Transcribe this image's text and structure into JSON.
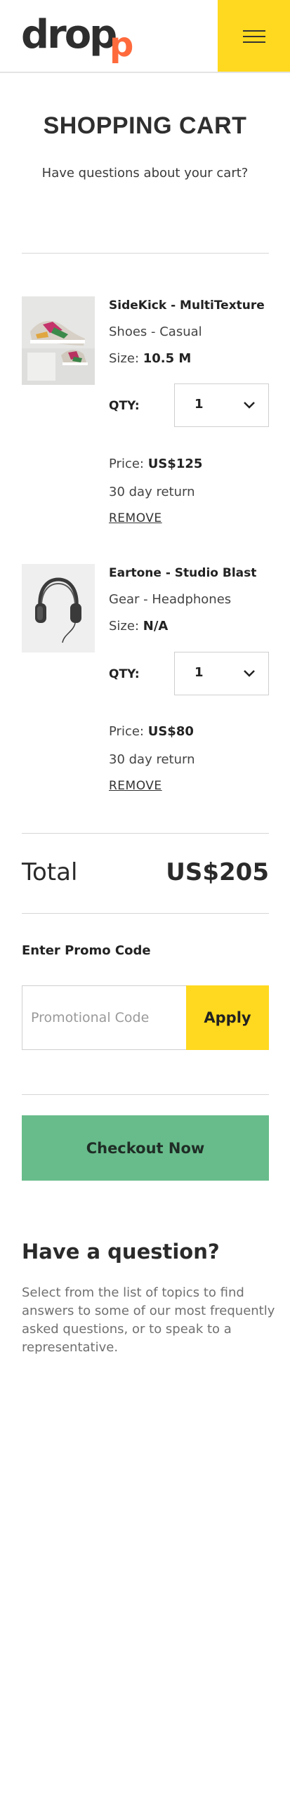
{
  "header": {
    "logo_main": "drop",
    "logo_accent": "p",
    "menu_icon": "hamburger-menu-icon",
    "brand_yellow": "#ffd91f",
    "brand_orange": "#ff6a3d"
  },
  "page": {
    "title": "SHOPPING CART",
    "subtitle": "Have questions about your cart?"
  },
  "cart": {
    "items": [
      {
        "name": "SideKick - MultiTexture",
        "category": "Shoes - Casual",
        "size_label": "Size:",
        "size_value": "10.5 M",
        "qty_label": "QTY:",
        "qty_value": "1",
        "price_label": "Price:",
        "price_value": "US$125",
        "return_policy": "30 day return",
        "remove_label": "REMOVE",
        "image_icon": "sneaker-image"
      },
      {
        "name": "Eartone - Studio Blast",
        "category": "Gear - Headphones",
        "size_label": "Size:",
        "size_value": "N/A",
        "qty_label": "QTY:",
        "qty_value": "1",
        "price_label": "Price:",
        "price_value": "US$80",
        "return_policy": "30 day return",
        "remove_label": "REMOVE",
        "image_icon": "headphones-image"
      }
    ],
    "total_label": "Total",
    "total_value": "US$205"
  },
  "promo": {
    "title": "Enter Promo Code",
    "placeholder": "Promotional Code",
    "apply_label": "Apply"
  },
  "checkout": {
    "label": "Checkout Now",
    "color": "#68bc8b"
  },
  "faq": {
    "title": "Have a question?",
    "text": "Select from the list of topics to find answers to some of our most frequently asked questions, or to speak to a representative."
  }
}
